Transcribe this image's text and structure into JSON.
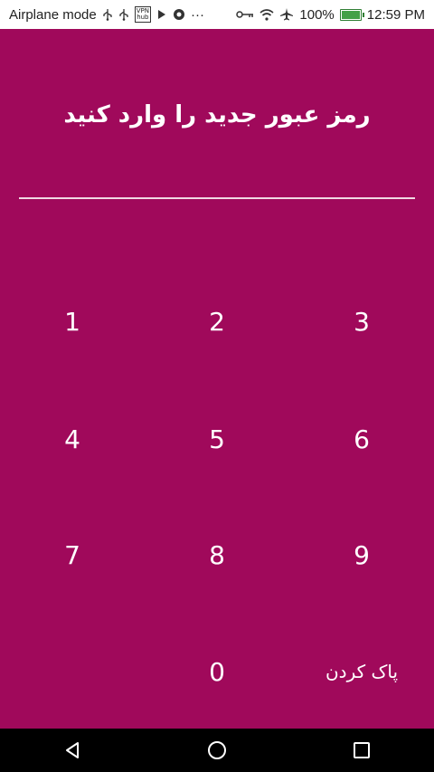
{
  "status_bar": {
    "left_text": "Airplane mode",
    "vpn_line1": "VPN",
    "vpn_line2": "hub",
    "overflow": "···",
    "battery_percent": "100%",
    "battery_level": 1.0,
    "time": "12:59 PM"
  },
  "screen": {
    "title": "رمز عبور جدید را وارد کنید",
    "background": "#a0095b",
    "keypad": {
      "row1": [
        "1",
        "2",
        "3"
      ],
      "row2": [
        "4",
        "5",
        "6"
      ],
      "row3": [
        "7",
        "8",
        "9"
      ],
      "zero": "0",
      "clear": "پاک کردن"
    }
  },
  "nav": {
    "back": "back-icon",
    "home": "home-icon",
    "recents": "recents-icon"
  }
}
